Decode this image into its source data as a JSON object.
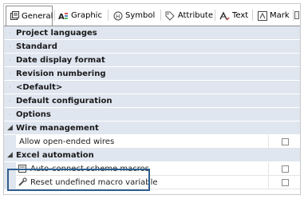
{
  "tabs": [
    {
      "label": "General",
      "icon": "general-icon",
      "active": true
    },
    {
      "label": "Graphic",
      "icon": "graphic-icon",
      "active": false
    },
    {
      "label": "Symbol",
      "icon": "symbol-icon",
      "active": false
    },
    {
      "label": "Attribute",
      "icon": "attribute-icon",
      "active": false
    },
    {
      "label": "Text",
      "icon": "text-icon",
      "active": false
    },
    {
      "label": "Mark",
      "icon": "mark-icon",
      "active": false
    }
  ],
  "categories": {
    "project_languages": "Project languages",
    "standard": "Standard",
    "date_display_format": "Date display format",
    "revision_numbering": "Revision numbering",
    "default": "<Default>",
    "default_configuration": "Default configuration",
    "options": "Options",
    "wire_management": "Wire management",
    "excel_automation": "Excel automation"
  },
  "items": {
    "allow_open_ended_wires": {
      "label": "Allow open-ended wires",
      "checked": false
    },
    "auto_connect_scheme_macros": {
      "label": "Auto-connect scheme macros",
      "checked": false
    },
    "reset_undefined_macro_variable": {
      "label": "Reset undefined macro variable",
      "checked": false
    }
  },
  "colors": {
    "category_bg": "#dfe6f0",
    "highlight_border": "#2f5f8f"
  }
}
